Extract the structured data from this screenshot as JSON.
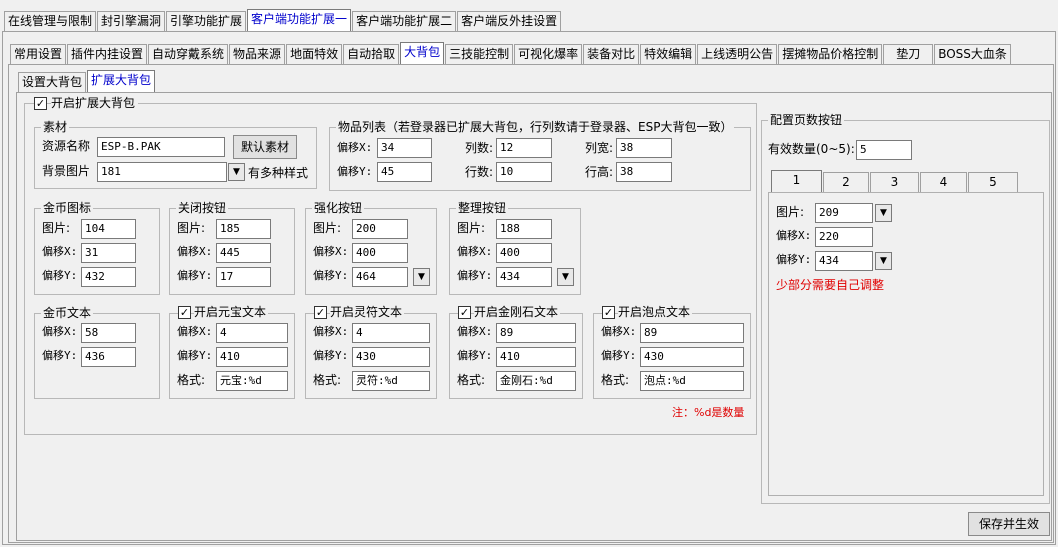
{
  "top_tabs": [
    "在线管理与限制",
    "封引擎漏洞",
    "引擎功能扩展",
    "客户端功能扩展一",
    "客户端功能扩展二",
    "客户端反外挂设置"
  ],
  "sub_tabs": [
    "常用设置",
    "插件内挂设置",
    "自动穿戴系统",
    "物品来源",
    "地面特效",
    "自动拾取",
    "大背包",
    "三技能控制",
    "可视化爆率",
    "装备对比",
    "特效编辑",
    "上线透明公告",
    "摆摊物品价格控制",
    "垫刀",
    "BOSS大血条"
  ],
  "bag_tabs": [
    "设置大背包",
    "扩展大背包"
  ],
  "enable_label": "开启扩展大背包",
  "material": {
    "title": "素材",
    "res_label": "资源名称",
    "res_value": "ESP-B.PAK",
    "default_btn": "默认素材",
    "bg_label": "背景图片",
    "bg_value": "181",
    "note": "有多种样式"
  },
  "item_list": {
    "title": "物品列表（若登录器已扩展大背包，行列数请于登录器、ESP大背包一致）",
    "offx_label": "偏移X:",
    "offx": "34",
    "cols_label": "列数:",
    "cols": "12",
    "colw_label": "列宽:",
    "colw": "38",
    "offy_label": "偏移Y:",
    "offy": "45",
    "rows_label": "行数:",
    "rows": "10",
    "rowh_label": "行高:",
    "rowh": "38"
  },
  "labels": {
    "pic": "图片:",
    "offx": "偏移X:",
    "offy": "偏移Y:",
    "fmt": "格式:"
  },
  "gold_icon": {
    "title": "金币图标",
    "pic": "104",
    "x": "31",
    "y": "432"
  },
  "close_btn": {
    "title": "关闭按钮",
    "pic": "185",
    "x": "445",
    "y": "17"
  },
  "enhance_btn": {
    "title": "强化按钮",
    "pic": "200",
    "x": "400",
    "y": "464"
  },
  "sort_btn": {
    "title": "整理按钮",
    "pic": "188",
    "x": "400",
    "y": "434"
  },
  "gold_text": {
    "title": "金币文本",
    "x": "58",
    "y": "436"
  },
  "yb_text": {
    "title": "开启元宝文本",
    "x": "4",
    "y": "410",
    "fmt": "元宝:%d"
  },
  "lf_text": {
    "title": "开启灵符文本",
    "x": "4",
    "y": "430",
    "fmt": "灵符:%d"
  },
  "jgs_text": {
    "title": "开启金刚石文本",
    "x": "89",
    "y": "410",
    "fmt": "金刚石:%d"
  },
  "pd_text": {
    "title": "开启泡点文本",
    "x": "89",
    "y": "430",
    "fmt": "泡点:%d"
  },
  "note": "注：%d是数量",
  "page_btn": {
    "title": "配置页数按钮",
    "count_label": "有效数量(0~5):",
    "count": "5",
    "tabs": [
      "1",
      "2",
      "3",
      "4",
      "5"
    ],
    "pic": "209",
    "x": "220",
    "y": "434",
    "hint": "少部分需要自己调整"
  },
  "save_btn": "保存并生效",
  "colors": {
    "accent_blue": "#0000cc",
    "warn_red": "#e00000"
  }
}
